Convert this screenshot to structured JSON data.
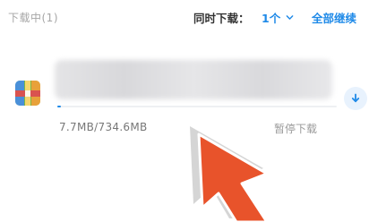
{
  "header": {
    "section_title": "下载中(1)",
    "concurrent_label": "同时下载：",
    "concurrent_value": "1个",
    "resume_all_label": "全部继续"
  },
  "download_item": {
    "downloaded": "7.7MB/734.6MB",
    "progress": 0.0105,
    "pause_label": "暂停下载",
    "icon": "archive-icon",
    "action_icon": "download-arrow-icon"
  },
  "overlay": {
    "icon": "pointer-arrow-icon",
    "color": "#e8532b"
  },
  "colors": {
    "accent": "#1f8ae8",
    "muted": "#a6a6a6"
  }
}
